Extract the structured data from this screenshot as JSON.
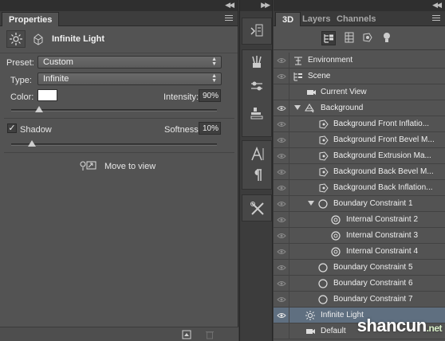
{
  "properties": {
    "tab_label": "Properties",
    "title": "Infinite Light",
    "preset_label": "Preset:",
    "preset_value": "Custom",
    "type_label": "Type:",
    "type_value": "Infinite",
    "color_label": "Color:",
    "color_value": "#ffffff",
    "intensity_label": "Intensity:",
    "intensity_value": "90%",
    "shadow_label": "Shadow",
    "shadow_checked": true,
    "softness_label": "Softness:",
    "softness_value": "10%",
    "move_to_view_label": "Move to view"
  },
  "panel3d": {
    "tabs": [
      "3D",
      "Layers",
      "Channels"
    ],
    "active_tab": "3D",
    "tree": [
      {
        "label": "Environment"
      },
      {
        "label": "Scene"
      },
      {
        "label": "Current View"
      },
      {
        "label": "Background"
      },
      {
        "label": "Background Front Inflatio..."
      },
      {
        "label": "Background Front Bevel M..."
      },
      {
        "label": "Background Extrusion Ma..."
      },
      {
        "label": "Background Back Bevel M..."
      },
      {
        "label": "Background Back Inflation..."
      },
      {
        "label": "Boundary Constraint 1"
      },
      {
        "label": "Internal Constraint 2"
      },
      {
        "label": "Internal Constraint 3"
      },
      {
        "label": "Internal Constraint 4"
      },
      {
        "label": "Boundary Constraint 5"
      },
      {
        "label": "Boundary Constraint 6"
      },
      {
        "label": "Boundary Constraint 7"
      },
      {
        "label": "Infinite Light"
      },
      {
        "label": "Default"
      }
    ],
    "selected": "Infinite Light"
  },
  "watermark": {
    "main": "shancun",
    "tld": ".net"
  },
  "colors": {
    "panel": "#535353",
    "selection": "#5f6f80",
    "dark": "#3a3a3a"
  }
}
